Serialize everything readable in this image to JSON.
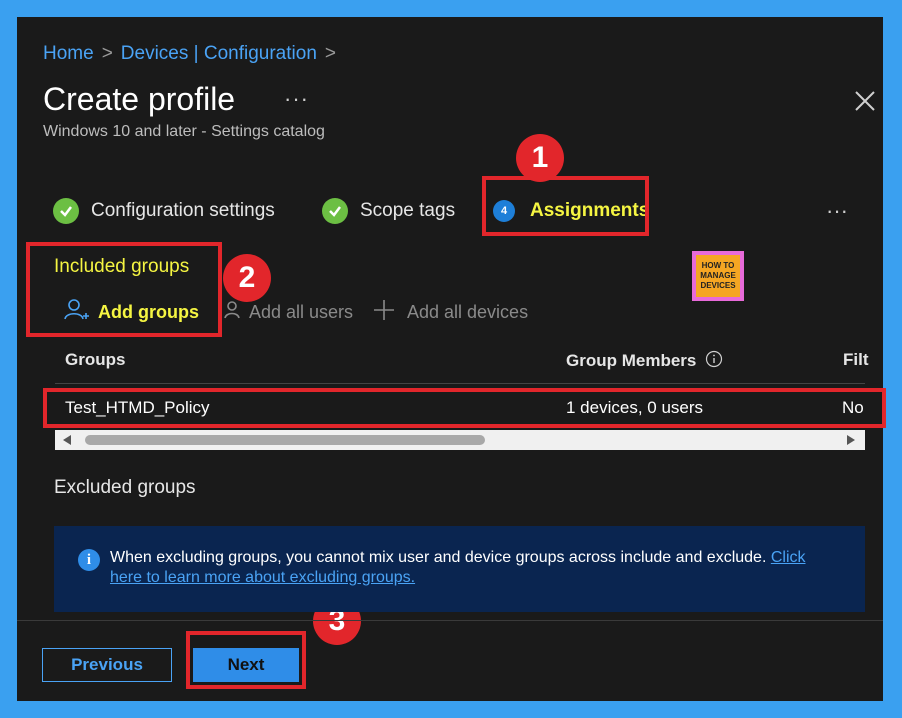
{
  "breadcrumb": {
    "home": "Home",
    "devices": "Devices | Configuration"
  },
  "header": {
    "title": "Create profile",
    "more": "···",
    "subtitle": "Windows 10 and later - Settings catalog"
  },
  "steps": [
    {
      "label": "Configuration settings"
    },
    {
      "label": "Scope tags"
    },
    {
      "label": "Assignments",
      "number": "4"
    }
  ],
  "steps_more": "···",
  "callouts": [
    "1",
    "2",
    "3"
  ],
  "included": {
    "title": "Included groups",
    "add_groups": "Add groups",
    "add_all_users": "Add all users",
    "add_all_devices": "Add all devices"
  },
  "logo": {
    "line1": "HOW TO",
    "line2": "MANAGE",
    "line3": "DEVICES"
  },
  "table": {
    "columns": [
      "Groups",
      "Group Members",
      "Filt"
    ],
    "rows": [
      {
        "group": "Test_HTMD_Policy",
        "members": "1 devices, 0 users",
        "filter": "No"
      }
    ]
  },
  "excluded": {
    "title": "Excluded groups",
    "info_text": "When excluding groups, you cannot mix user and device groups across include and exclude. ",
    "info_link_1": "Click",
    "info_link_2": "here to learn more about excluding groups."
  },
  "footer": {
    "previous": "Previous",
    "next": "Next"
  },
  "colors": {
    "accent": "#4aa3f5",
    "highlight": "#e2262b",
    "active_text": "#f5f542",
    "success": "#6cbf43"
  }
}
